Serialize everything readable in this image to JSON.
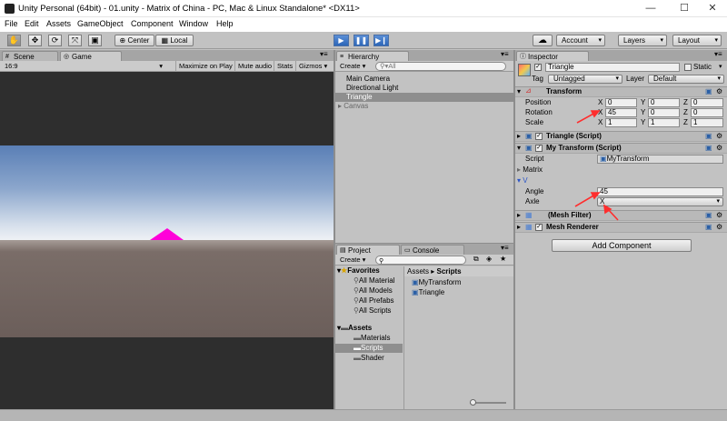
{
  "window": {
    "title": "Unity Personal (64bit) - 01.unity - Matrix of China - PC, Mac & Linux Standalone* <DX11>",
    "min": "—",
    "max": "☐",
    "close": "✕"
  },
  "menu": [
    "File",
    "Edit",
    "Assets",
    "GameObject",
    "Component",
    "Window",
    "Help"
  ],
  "toolbar": {
    "center": "Center",
    "local": "Local",
    "play": "▶",
    "pause": "❚❚",
    "step": "▶❙",
    "account": "Account",
    "layers": "Layers",
    "layout": "Layout",
    "cloud": "☁",
    "tools": [
      "✋",
      "✥",
      "⟳",
      "⤧",
      "▣"
    ]
  },
  "scene": {
    "tab_scene": "Scene",
    "tab_game": "Game",
    "aspect": "16:9",
    "maximize": "Maximize on Play",
    "mute": "Mute audio",
    "stats": "Stats",
    "gizmos": "Gizmos"
  },
  "hierarchy": {
    "tab": "Hierarchy",
    "create": "Create",
    "search": "▾All",
    "items": [
      "Main Camera",
      "Directional Light",
      "Triangle",
      "Canvas"
    ]
  },
  "project": {
    "tab": "Project",
    "tab_console": "Console",
    "create": "Create",
    "breadcrumb_root": "Assets",
    "breadcrumb_sep": "▸",
    "breadcrumb_leaf": "Scripts",
    "favorites": "Favorites",
    "fav_items": [
      "All Material",
      "All Models",
      "All Prefabs",
      "All Scripts"
    ],
    "assets": "Assets",
    "asset_folders": [
      "Materials",
      "Scripts",
      "Shader"
    ],
    "files": [
      "MyTransform",
      "Triangle"
    ]
  },
  "inspector": {
    "tab": "Inspector",
    "object_name": "Triangle",
    "static": "Static",
    "tag_label": "Tag",
    "tag": "Untagged",
    "layer_label": "Layer",
    "layer": "Default",
    "transform": {
      "title": "Transform",
      "position": "Position",
      "rotation": "Rotation",
      "scale": "Scale",
      "pos": [
        "0",
        "0",
        "0"
      ],
      "rot": [
        "45",
        "0",
        "0"
      ],
      "scl": [
        "1",
        "1",
        "1"
      ],
      "axes": [
        "X",
        "Y",
        "Z"
      ]
    },
    "triangle_script": "Triangle (Script)",
    "my_transform": "My Transform (Script)",
    "script_label": "Script",
    "script_value": "MyTransform",
    "matrix": "Matrix",
    "v": "V",
    "angle_label": "Angle",
    "angle": "45",
    "axle_label": "Axle",
    "axle": "X",
    "mesh_filter": "(Mesh Filter)",
    "mesh_renderer": "Mesh Renderer",
    "add_component": "Add Component"
  },
  "colors": {
    "accent": "#3e7de0",
    "triangle": "#ff00d9",
    "sky_top": "#5a7fb6",
    "sky_horizon": "#e9eef5",
    "ground": "#6b5e5a",
    "viewport_bg": "#2e2e2e",
    "arrow": "#ff2d2d"
  }
}
